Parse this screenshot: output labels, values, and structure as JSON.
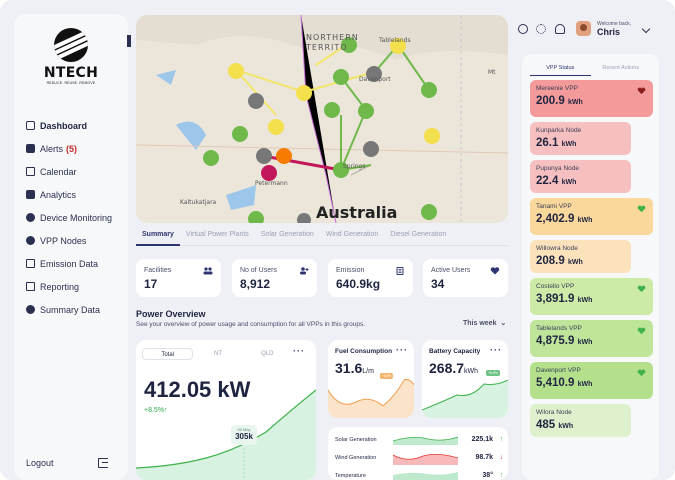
{
  "sidebar": {
    "logo": {
      "name": "NTECH",
      "tagline": "REDUCE. REUSE. REMOVE"
    },
    "items": [
      {
        "label": "Dashboard",
        "icon": "grid-icon",
        "active": true
      },
      {
        "label": "Alerts",
        "icon": "alert-icon",
        "badge": "(5)"
      },
      {
        "label": "Calendar",
        "icon": "calendar-icon"
      },
      {
        "label": "Analytics",
        "icon": "analytics-icon"
      },
      {
        "label": "Device Monitoring",
        "icon": "users-icon"
      },
      {
        "label": "VPP Nodes",
        "icon": "nodes-icon"
      },
      {
        "label": "Emission Data",
        "icon": "emission-icon"
      },
      {
        "label": "Reporting",
        "icon": "report-icon"
      },
      {
        "label": "Summary Data",
        "icon": "pie-icon"
      }
    ],
    "logout": "Logout"
  },
  "map": {
    "labels": {
      "territory_top": "NORTHERN",
      "territory_bottom": "TERRITO",
      "tablelands": "Tablelands",
      "davenport": "Davenport",
      "springs": "Springs",
      "petermann": "Petermann",
      "kaltukatjara": "Kaltukatjara",
      "australia": "Australia",
      "edge": "Mt"
    }
  },
  "tabs": [
    "Summary",
    "Virtual Power Plants",
    "Solar Generation",
    "Wind Generation",
    "Diesel Generation"
  ],
  "stats": [
    {
      "label": "Facilities",
      "value": "17",
      "icon": "team-icon"
    },
    {
      "label": "No of Users",
      "value": "8,912",
      "icon": "add-user-icon"
    },
    {
      "label": "Emission",
      "value": "640.9kg",
      "icon": "document-icon"
    },
    {
      "label": "Active Users",
      "value": "34",
      "icon": "heart-icon"
    }
  ],
  "power_overview": {
    "title": "Power Overview",
    "subtitle": "See your overview of power usage and consumption for all VPPs in this groups.",
    "period": "This week",
    "segments": [
      "Total",
      "NT",
      "QLD"
    ],
    "value": "412.05 kW",
    "change": "+8.5%↑",
    "tooltip_label": "05 May",
    "tooltip_value": "305k"
  },
  "fuel": {
    "title": "Fuel Consumption",
    "value": "31.6",
    "unit": "L/m",
    "badge": "+44%"
  },
  "battery": {
    "title": "Battery Capacity",
    "value": "268.7",
    "unit": "kWh",
    "badge": "+6.8%"
  },
  "generation": [
    {
      "label": "Solar Generation",
      "value": "225.1k",
      "arrow": "↑",
      "trend": "up"
    },
    {
      "label": "Wind Generation",
      "value": "98.7k",
      "arrow": "↓",
      "trend": "down"
    },
    {
      "label": "Temperature",
      "value": "38°",
      "arrow": "↑",
      "trend": "up"
    }
  ],
  "header": {
    "welcome": "Welcome back,",
    "user": "Chris"
  },
  "vpp_panel": {
    "tabs": [
      "VPP Status",
      "Recent Actions"
    ],
    "items": [
      {
        "name": "Mereenie VPP",
        "value": "200.9",
        "unit": "kWh",
        "color": "#f49a9a",
        "heart": "#8b1e1e"
      },
      {
        "name": "Kunparka Node",
        "value": "26.1",
        "unit": "kWh",
        "color": "#f7c0c0"
      },
      {
        "name": "Pupunya Node",
        "value": "22.4",
        "unit": "kWh",
        "color": "#f7c0c0"
      },
      {
        "name": "Tanami VPP",
        "value": "2,402.9",
        "unit": "kWh",
        "color": "#fad79a",
        "heart": "#3fb24b"
      },
      {
        "name": "Willowra Node",
        "value": "208.9",
        "unit": "kWh",
        "color": "#fbe2bb"
      },
      {
        "name": "Costello VPP",
        "value": "3,891.9",
        "unit": "kWh",
        "color": "#cdeaa6",
        "heart": "#3fb24b"
      },
      {
        "name": "Tablelands VPP",
        "value": "4,875.9",
        "unit": "kWh",
        "color": "#bfe59a",
        "heart": "#3fb24b"
      },
      {
        "name": "Davenport VPP",
        "value": "5,410.9",
        "unit": "kWh",
        "color": "#b4e08c",
        "heart": "#3fb24b"
      },
      {
        "name": "Wilora Node",
        "value": "485",
        "unit": "kWh",
        "color": "#dff1cc"
      }
    ]
  }
}
